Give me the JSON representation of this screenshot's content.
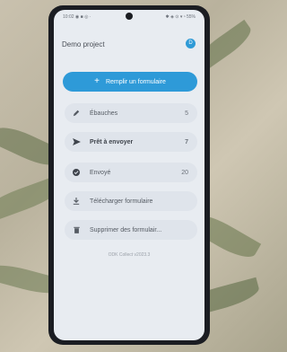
{
  "status_bar": {
    "left": "10:02 ◉ ■ ◎ ·",
    "right": "✱ ◈ ⊙ ▾ ⁿ 55%"
  },
  "header": {
    "title": "Demo project",
    "avatar_letter": "D"
  },
  "main": {
    "fill_form_label": "Remplir un formulaire",
    "items": [
      {
        "label": "Ébauches",
        "count": "5",
        "icon": "pencil-icon"
      },
      {
        "label": "Prêt à envoyer",
        "count": "7",
        "icon": "send-icon"
      },
      {
        "label": "Envoyé",
        "count": "20",
        "icon": "check-circle-icon"
      },
      {
        "label": "Télécharger formulaire",
        "icon": "download-icon"
      },
      {
        "label": "Supprimer des formulair...",
        "icon": "trash-icon"
      }
    ]
  },
  "footer": {
    "version": "ODK Collect v2023.3"
  },
  "colors": {
    "accent": "#2e9ad8",
    "screen_bg": "#e8ecf1",
    "row_bg": "#dfe4eb"
  }
}
